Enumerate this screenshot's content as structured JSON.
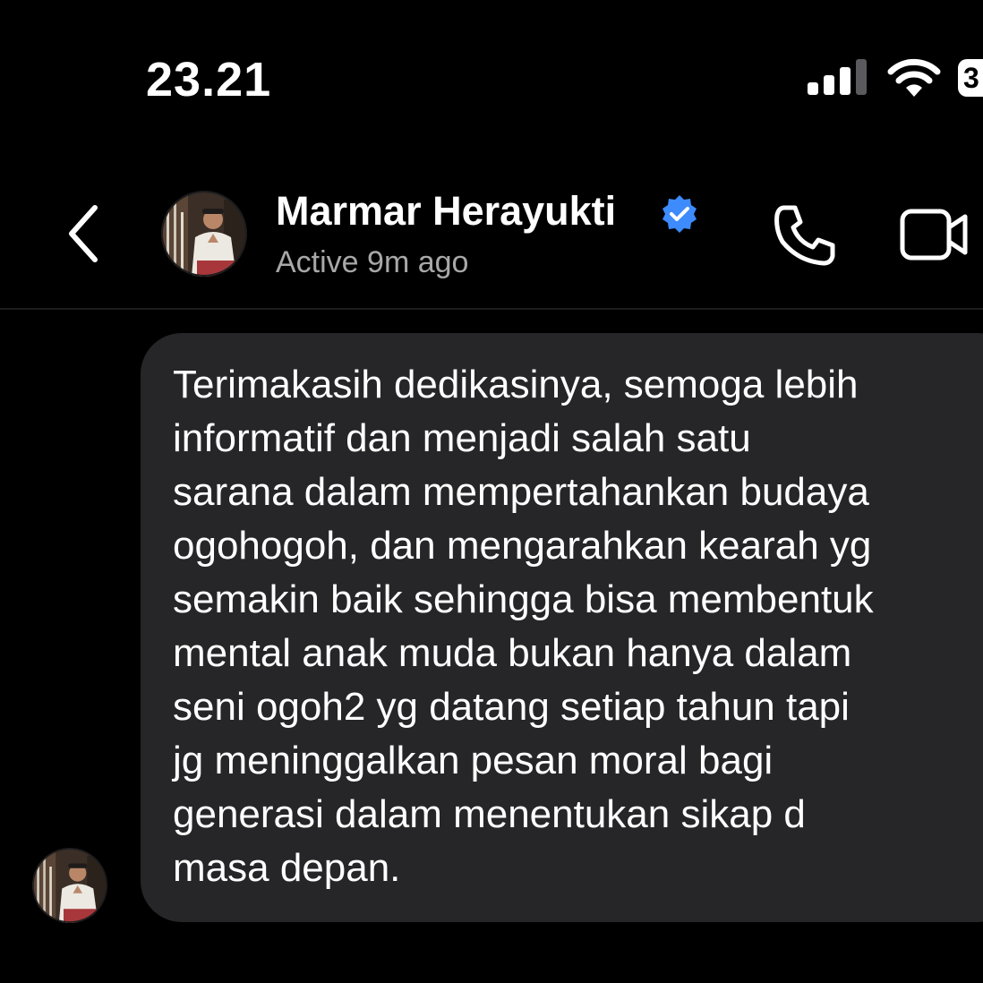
{
  "status_bar": {
    "time": "23.21",
    "battery_level_text": "3"
  },
  "header": {
    "contact_name": "Marmar Herayukti",
    "active_status": "Active 9m ago",
    "icons": [
      "back-icon",
      "avatar",
      "verified-icon",
      "phone-icon",
      "video-icon"
    ]
  },
  "message": {
    "text": "Terimakasih dedikasinya, semoga lebih\ninformatif dan menjadi salah satu\nsarana dalam mempertahankan budaya\nogohogoh, dan mengarahkan kearah yg\nsemakin baik sehingga bisa membentuk\nmental anak muda bukan hanya dalam\nseni ogoh2 yg datang setiap tahun tapi\njg meninggalkan pesan moral bagi\ngenerasi dalam menentukan sikap d\nmasa depan."
  },
  "colors": {
    "background": "#000000",
    "bubble": "#262628",
    "text_primary": "#ffffff",
    "text_secondary": "#a8a8a8",
    "verified_blue": "#3d8bfd"
  }
}
